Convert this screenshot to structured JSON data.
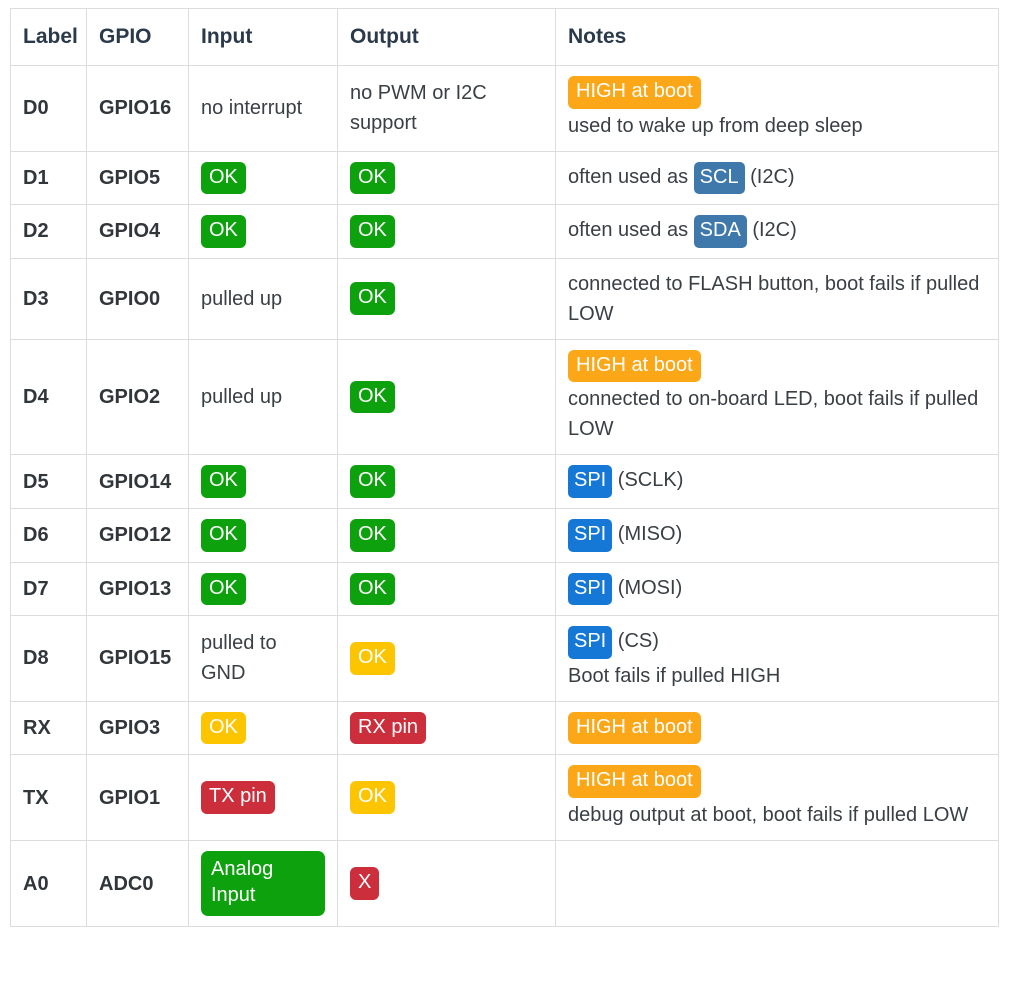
{
  "table": {
    "columns": [
      "Label",
      "GPIO",
      "Input",
      "Output",
      "Notes"
    ],
    "colors": {
      "ok_green": "#0ea10e",
      "ok_yellow": "#fdc500",
      "pin_red": "#cc2e3c",
      "boot_orange": "#fba718",
      "spi_blue": "#1578d6",
      "i2c_steel_blue": "#3f78ab",
      "border": "#dddddd",
      "header_text": "#2b3a4a",
      "body_text": "#3a3f44"
    },
    "rows": [
      {
        "label": "D0",
        "gpio": "GPIO16",
        "input": {
          "text": "no interrupt"
        },
        "output": {
          "text": "no PWM or I2C support"
        },
        "notes": {
          "badge": "HIGH at boot",
          "badge_color": "orange",
          "text": "used to wake up from deep sleep"
        }
      },
      {
        "label": "D1",
        "gpio": "GPIO5",
        "input": {
          "badge": "OK",
          "badge_color": "green"
        },
        "output": {
          "badge": "OK",
          "badge_color": "green"
        },
        "notes": {
          "prefix": "often used as",
          "inline_badge": "SCL",
          "inline_badge_color": "steel",
          "suffix": "(I2C)"
        }
      },
      {
        "label": "D2",
        "gpio": "GPIO4",
        "input": {
          "badge": "OK",
          "badge_color": "green"
        },
        "output": {
          "badge": "OK",
          "badge_color": "green"
        },
        "notes": {
          "prefix": "often used as",
          "inline_badge": "SDA",
          "inline_badge_color": "steel",
          "suffix": "(I2C)"
        }
      },
      {
        "label": "D3",
        "gpio": "GPIO0",
        "input": {
          "text": "pulled up"
        },
        "output": {
          "badge": "OK",
          "badge_color": "green"
        },
        "notes": {
          "text": "connected to FLASH button, boot fails if pulled LOW"
        }
      },
      {
        "label": "D4",
        "gpio": "GPIO2",
        "input": {
          "text": "pulled up"
        },
        "output": {
          "badge": "OK",
          "badge_color": "green"
        },
        "notes": {
          "badge": "HIGH at boot",
          "badge_color": "orange",
          "text": "connected to on-board LED, boot fails if pulled LOW"
        }
      },
      {
        "label": "D5",
        "gpio": "GPIO14",
        "input": {
          "badge": "OK",
          "badge_color": "green"
        },
        "output": {
          "badge": "OK",
          "badge_color": "green"
        },
        "notes": {
          "inline_badge": "SPI",
          "inline_badge_color": "blue",
          "suffix": "(SCLK)"
        }
      },
      {
        "label": "D6",
        "gpio": "GPIO12",
        "input": {
          "badge": "OK",
          "badge_color": "green"
        },
        "output": {
          "badge": "OK",
          "badge_color": "green"
        },
        "notes": {
          "inline_badge": "SPI",
          "inline_badge_color": "blue",
          "suffix": "(MISO)"
        }
      },
      {
        "label": "D7",
        "gpio": "GPIO13",
        "input": {
          "badge": "OK",
          "badge_color": "green"
        },
        "output": {
          "badge": "OK",
          "badge_color": "green"
        },
        "notes": {
          "inline_badge": "SPI",
          "inline_badge_color": "blue",
          "suffix": "(MOSI)"
        }
      },
      {
        "label": "D8",
        "gpio": "GPIO15",
        "input": {
          "text": "pulled to GND"
        },
        "output": {
          "badge": "OK",
          "badge_color": "yellow"
        },
        "notes": {
          "inline_badge": "SPI",
          "inline_badge_color": "blue",
          "suffix": "(CS)",
          "text": "Boot fails if pulled HIGH"
        }
      },
      {
        "label": "RX",
        "gpio": "GPIO3",
        "input": {
          "badge": "OK",
          "badge_color": "yellow"
        },
        "output": {
          "badge": "RX pin",
          "badge_color": "red"
        },
        "notes": {
          "badge": "HIGH at boot",
          "badge_color": "orange"
        }
      },
      {
        "label": "TX",
        "gpio": "GPIO1",
        "input": {
          "badge": "TX pin",
          "badge_color": "red"
        },
        "output": {
          "badge": "OK",
          "badge_color": "yellow"
        },
        "notes": {
          "badge": "HIGH at boot",
          "badge_color": "orange",
          "text": "debug output at boot, boot fails if pulled LOW"
        }
      },
      {
        "label": "A0",
        "gpio": "ADC0",
        "input": {
          "badge": "Analog Input",
          "badge_color": "green",
          "block": true
        },
        "output": {
          "badge": "X",
          "badge_color": "red"
        },
        "notes": {}
      }
    ]
  }
}
